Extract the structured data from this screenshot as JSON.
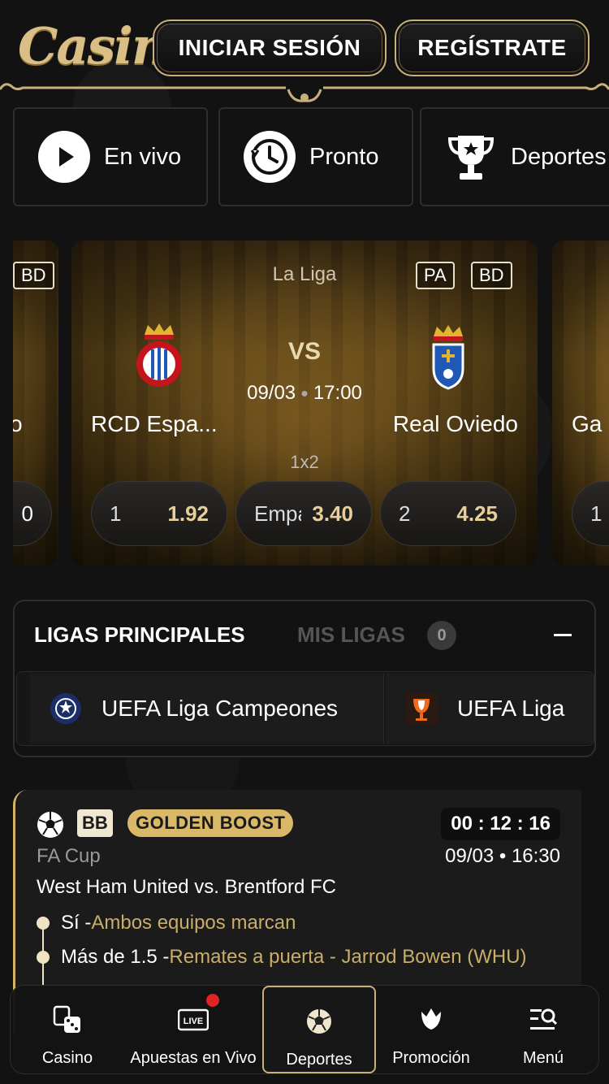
{
  "header": {
    "logo_text": "Casina",
    "login_label": "INICIAR SESIÓN",
    "register_label": "REGÍSTRATE"
  },
  "categories": [
    {
      "label": "En vivo",
      "icon": "play-icon"
    },
    {
      "label": "Pronto",
      "icon": "history-icon"
    },
    {
      "label": "Deportes",
      "icon": "trophy-icon"
    }
  ],
  "carousel": {
    "left_card": {
      "tag": "BD",
      "team_partial": "o",
      "odd_partial": "0"
    },
    "main_card": {
      "league": "La Liga",
      "tags": [
        "PA",
        "BD"
      ],
      "vs": "VS",
      "date": "09/03",
      "time": "17:00",
      "home_team": "RCD Espa...",
      "away_team": "Real Oviedo",
      "market": "1x2",
      "odds": [
        {
          "key": "1",
          "value": "1.92"
        },
        {
          "key": "Empate",
          "value": "3.40"
        },
        {
          "key": "2",
          "value": "4.25"
        }
      ]
    },
    "right_card": {
      "team_partial": "Ga",
      "odd_partial": "1"
    }
  },
  "leagues": {
    "tab_main": "LIGAS PRINCIPALES",
    "tab_mine": "MIS LIGAS",
    "mine_count": "0",
    "items": [
      {
        "label": "UEFA Liga Campeones",
        "icon": "champions-league-icon"
      },
      {
        "label": "UEFA Liga",
        "icon": "europa-league-icon"
      }
    ]
  },
  "boost": {
    "badge_bb": "BB",
    "badge_golden": "GOLDEN BOOST",
    "timer": "00 : 12 : 16",
    "competition": "FA Cup",
    "date_time": "09/03 • 16:30",
    "match": "West Ham United vs. Brentford FC",
    "selections": [
      {
        "pick": "Sí - ",
        "market": "Ambos equipos marcan"
      },
      {
        "pick": "Más de 1.5 - ",
        "market": "Remates a puerta - Jarrod Bowen (WHU)"
      }
    ]
  },
  "bottom_nav": [
    {
      "label": "Casino",
      "icon": "casino-dice-icon"
    },
    {
      "label": "Apuestas en Vivo",
      "icon": "live-icon"
    },
    {
      "label": "Deportes",
      "icon": "soccer-ball-icon"
    },
    {
      "label": "Promoción",
      "icon": "tulip-icon"
    },
    {
      "label": "Menú",
      "icon": "menu-search-icon"
    }
  ],
  "live_icon_text": "LIVE",
  "colors": {
    "accent_gold": "#d4b36a",
    "background": "#121212",
    "live_red": "#e02424"
  }
}
